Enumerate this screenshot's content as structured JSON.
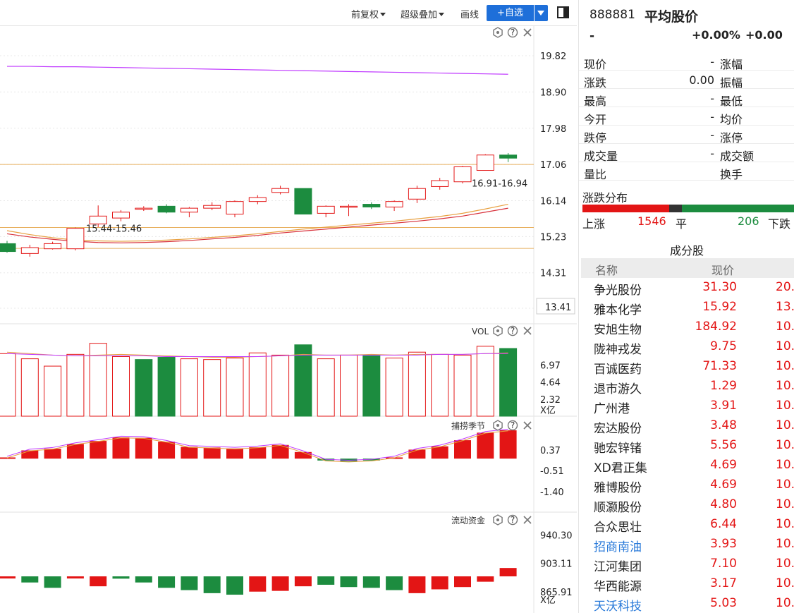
{
  "toolbar": {
    "restore": "前复权",
    "overlay": "超级叠加",
    "draw": "画线",
    "watch": "+自选"
  },
  "chart_data": [
    {
      "type": "candlestick",
      "ylim": [
        13.41,
        19.82
      ],
      "yticks": [
        19.82,
        18.9,
        17.98,
        17.06,
        16.14,
        15.23,
        14.31,
        13.41
      ],
      "candles": [
        {
          "o": 15.05,
          "c": 14.85,
          "h": 15.12,
          "l": 14.82,
          "dir": "down"
        },
        {
          "o": 14.8,
          "c": 14.95,
          "h": 15.02,
          "l": 14.72,
          "dir": "up"
        },
        {
          "o": 14.92,
          "c": 15.05,
          "h": 15.1,
          "l": 14.9,
          "dir": "up"
        },
        {
          "o": 14.92,
          "c": 15.44,
          "h": 15.46,
          "l": 14.88,
          "dir": "up"
        },
        {
          "o": 15.55,
          "c": 15.75,
          "h": 16.02,
          "l": 15.47,
          "dir": "up"
        },
        {
          "o": 15.7,
          "c": 15.85,
          "h": 15.9,
          "l": 15.62,
          "dir": "up"
        },
        {
          "o": 15.93,
          "c": 15.95,
          "h": 16.0,
          "l": 15.88,
          "dir": "up"
        },
        {
          "o": 16.0,
          "c": 15.85,
          "h": 16.05,
          "l": 15.82,
          "dir": "down"
        },
        {
          "o": 15.85,
          "c": 15.95,
          "h": 15.98,
          "l": 15.72,
          "dir": "up"
        },
        {
          "o": 15.95,
          "c": 16.02,
          "h": 16.1,
          "l": 15.9,
          "dir": "up"
        },
        {
          "o": 15.8,
          "c": 16.12,
          "h": 16.15,
          "l": 15.72,
          "dir": "up"
        },
        {
          "o": 16.12,
          "c": 16.22,
          "h": 16.28,
          "l": 16.05,
          "dir": "up"
        },
        {
          "o": 16.35,
          "c": 16.45,
          "h": 16.52,
          "l": 16.3,
          "dir": "up"
        },
        {
          "o": 16.45,
          "c": 15.8,
          "h": 16.45,
          "l": 15.8,
          "dir": "down"
        },
        {
          "o": 15.82,
          "c": 16.0,
          "h": 16.02,
          "l": 15.72,
          "dir": "up"
        },
        {
          "o": 16.0,
          "c": 16.0,
          "h": 16.05,
          "l": 15.75,
          "dir": "up"
        },
        {
          "o": 16.05,
          "c": 15.98,
          "h": 16.1,
          "l": 15.93,
          "dir": "down"
        },
        {
          "o": 15.98,
          "c": 16.12,
          "h": 16.15,
          "l": 15.88,
          "dir": "up"
        },
        {
          "o": 16.18,
          "c": 16.45,
          "h": 16.52,
          "l": 16.08,
          "dir": "up"
        },
        {
          "o": 16.5,
          "c": 16.65,
          "h": 16.72,
          "l": 16.42,
          "dir": "up"
        },
        {
          "o": 16.62,
          "c": 17.0,
          "h": 17.02,
          "l": 16.58,
          "dir": "up"
        },
        {
          "o": 16.91,
          "c": 17.3,
          "h": 17.32,
          "l": 16.94,
          "dir": "up"
        },
        {
          "o": 17.3,
          "c": 17.22,
          "h": 17.35,
          "l": 17.12,
          "dir": "down"
        }
      ],
      "ma": [
        {
          "color": "#c03aff",
          "values": [
            19.55,
            19.55,
            19.54,
            19.54,
            19.53,
            19.52,
            19.51,
            19.5,
            19.49,
            19.48,
            19.47,
            19.46,
            19.45,
            19.44,
            19.43,
            19.42,
            19.41,
            19.4,
            19.39,
            19.38,
            19.37,
            19.36,
            19.35
          ]
        },
        {
          "color": "#e8a040",
          "values": [
            15.38,
            15.28,
            15.2,
            15.14,
            15.12,
            15.11,
            15.12,
            15.14,
            15.17,
            15.21,
            15.25,
            15.3,
            15.36,
            15.42,
            15.47,
            15.52,
            15.57,
            15.62,
            15.68,
            15.74,
            15.82,
            15.93,
            16.05
          ]
        },
        {
          "color": "#d8323c",
          "values": [
            15.3,
            15.22,
            15.16,
            15.11,
            15.08,
            15.07,
            15.08,
            15.1,
            15.13,
            15.17,
            15.21,
            15.26,
            15.32,
            15.37,
            15.42,
            15.47,
            15.52,
            15.57,
            15.62,
            15.68,
            15.75,
            15.85,
            15.95
          ]
        }
      ],
      "hlines": [
        {
          "v": 17.06,
          "color": "#e8b060"
        },
        {
          "v": 15.46,
          "color": "#e8b060"
        },
        {
          "v": 14.93,
          "color": "#e8b060"
        }
      ],
      "annotations": [
        "15.44-15.46",
        "16.91-16.94"
      ]
    },
    {
      "type": "bar",
      "label": "VOL",
      "ylim": [
        0,
        11.5
      ],
      "yticks": [
        6.97,
        4.64,
        2.32
      ],
      "unit": "X亿",
      "values": [
        8.5,
        7.8,
        6.8,
        8.4,
        9.9,
        8.1,
        7.7,
        8.0,
        7.8,
        7.7,
        7.9,
        8.6,
        8.3,
        9.7,
        7.8,
        8.3,
        8.2,
        7.9,
        8.7,
        8.4,
        8.3,
        9.5,
        9.2
      ],
      "colors": [
        "up",
        "up",
        "up",
        "up",
        "up",
        "up",
        "down",
        "down",
        "up",
        "up",
        "up",
        "up",
        "up",
        "down",
        "up",
        "up",
        "down",
        "up",
        "up",
        "up",
        "up",
        "up",
        "down"
      ],
      "ma": [
        {
          "color": "#e8a040",
          "values": [
            8.7,
            8.5,
            8.3,
            8.2,
            8.3,
            8.4,
            8.3,
            8.2,
            8.1,
            8.0,
            8.0,
            8.1,
            8.2,
            8.4,
            8.3,
            8.3,
            8.4,
            8.3,
            8.4,
            8.4,
            8.4,
            8.5,
            8.6
          ]
        },
        {
          "color": "#c03aff",
          "values": [
            8.5,
            8.4,
            8.3,
            8.2,
            8.2,
            8.2,
            8.2,
            8.1,
            8.1,
            8.1,
            8.1,
            8.1,
            8.2,
            8.3,
            8.3,
            8.3,
            8.3,
            8.3,
            8.3,
            8.4,
            8.4,
            8.5,
            8.5
          ]
        }
      ]
    },
    {
      "type": "bar",
      "label": "捕捞季节",
      "ylim": [
        -2.0,
        1.5
      ],
      "yticks": [
        0.37,
        -0.51,
        -1.4
      ],
      "values": [
        0.05,
        0.35,
        0.42,
        0.62,
        0.75,
        0.9,
        0.88,
        0.72,
        0.5,
        0.47,
        0.43,
        0.48,
        0.58,
        0.28,
        -0.08,
        -0.12,
        -0.08,
        0.05,
        0.38,
        0.52,
        0.78,
        1.1,
        1.2
      ],
      "colors": [
        "up",
        "up",
        "up",
        "up",
        "up",
        "up",
        "up",
        "up",
        "up",
        "up",
        "up",
        "up",
        "up",
        "up",
        "down",
        "down",
        "down",
        "up",
        "up",
        "up",
        "up",
        "up",
        "up"
      ]
    },
    {
      "type": "bar",
      "label": "流动资金",
      "ylim": [
        838,
        960
      ],
      "yticks": [
        940.3,
        903.11,
        865.91
      ],
      "unit": "X亿",
      "zero": 886,
      "values": [
        886,
        878,
        871,
        885,
        873,
        883,
        878,
        871,
        868,
        864,
        862,
        866,
        867,
        873,
        875,
        872,
        871,
        868,
        864,
        869,
        872,
        879,
        886
      ],
      "colors": [
        "up",
        "down",
        "down",
        "up",
        "up",
        "down",
        "down",
        "down",
        "down",
        "down",
        "down",
        "up",
        "up",
        "up",
        "down",
        "down",
        "down",
        "down",
        "up",
        "up",
        "up",
        "up",
        "up"
      ],
      "tops": [
        886,
        886,
        886,
        886,
        886,
        886,
        886,
        886,
        886,
        886,
        886,
        886,
        886,
        886,
        886,
        886,
        886,
        886,
        886,
        886,
        886,
        886,
        897
      ]
    }
  ],
  "panel": {
    "code": "888881",
    "name": "平均股价",
    "price": "-",
    "pct": "+0.00%",
    "chg": "+0.00",
    "quote": [
      {
        "l1": "现价",
        "v1": "-",
        "l2": "涨幅"
      },
      {
        "l1": "涨跌",
        "v1": "0.00",
        "l2": "振幅"
      },
      {
        "l1": "最高",
        "v1": "-",
        "l2": "最低"
      },
      {
        "l1": "今开",
        "v1": "-",
        "l2": "均价"
      },
      {
        "l1": "跌停",
        "v1": "-",
        "l2": "涨停"
      },
      {
        "l1": "成交量",
        "v1": "-",
        "l2": "成交额"
      },
      {
        "l1": "量比",
        "v1": "",
        "l2": "换手"
      }
    ],
    "dist": {
      "title": "涨跌分布",
      "up_label": "上涨",
      "up": "1546",
      "flat_label": "平",
      "down": "206",
      "down_label": "下跌",
      "up_frac": 0.41,
      "flat_frac": 0.06,
      "down_frac": 0.53
    },
    "constituents": {
      "title": "成分股",
      "col_name": "名称",
      "col_price": "现价",
      "rows": [
        {
          "name": "争光股份",
          "price": "31.30",
          "chg": "20.",
          "blue": false
        },
        {
          "name": "雅本化学",
          "price": "15.92",
          "chg": "13.",
          "blue": false
        },
        {
          "name": "安旭生物",
          "price": "184.92",
          "chg": "10.",
          "blue": false
        },
        {
          "name": "陇神戎发",
          "price": "9.75",
          "chg": "10.",
          "blue": false
        },
        {
          "name": "百诚医药",
          "price": "71.33",
          "chg": "10.",
          "blue": false
        },
        {
          "name": "退市游久",
          "price": "1.29",
          "chg": "10.",
          "blue": false
        },
        {
          "name": "广州港",
          "price": "3.91",
          "chg": "10.",
          "blue": false
        },
        {
          "name": "宏达股份",
          "price": "3.48",
          "chg": "10.",
          "blue": false
        },
        {
          "name": "驰宏锌锗",
          "price": "5.56",
          "chg": "10.",
          "blue": false
        },
        {
          "name": "XD君正集",
          "price": "4.69",
          "chg": "10.",
          "blue": false
        },
        {
          "name": "雅博股份",
          "price": "4.69",
          "chg": "10.",
          "blue": false
        },
        {
          "name": "顺灏股份",
          "price": "4.80",
          "chg": "10.",
          "blue": false
        },
        {
          "name": "合众思壮",
          "price": "6.44",
          "chg": "10.",
          "blue": false
        },
        {
          "name": "招商南油",
          "price": "3.93",
          "chg": "10.",
          "blue": true
        },
        {
          "name": "江河集团",
          "price": "7.10",
          "chg": "10.",
          "blue": false
        },
        {
          "name": "华西能源",
          "price": "3.17",
          "chg": "10.",
          "blue": false
        },
        {
          "name": "天沃科技",
          "price": "5.03",
          "chg": "10.",
          "blue": true
        }
      ]
    }
  },
  "colors": {
    "up": "#e31515",
    "down": "#1c8c3f",
    "accent": "#1e6fd9",
    "link": "#2a7ad9"
  }
}
